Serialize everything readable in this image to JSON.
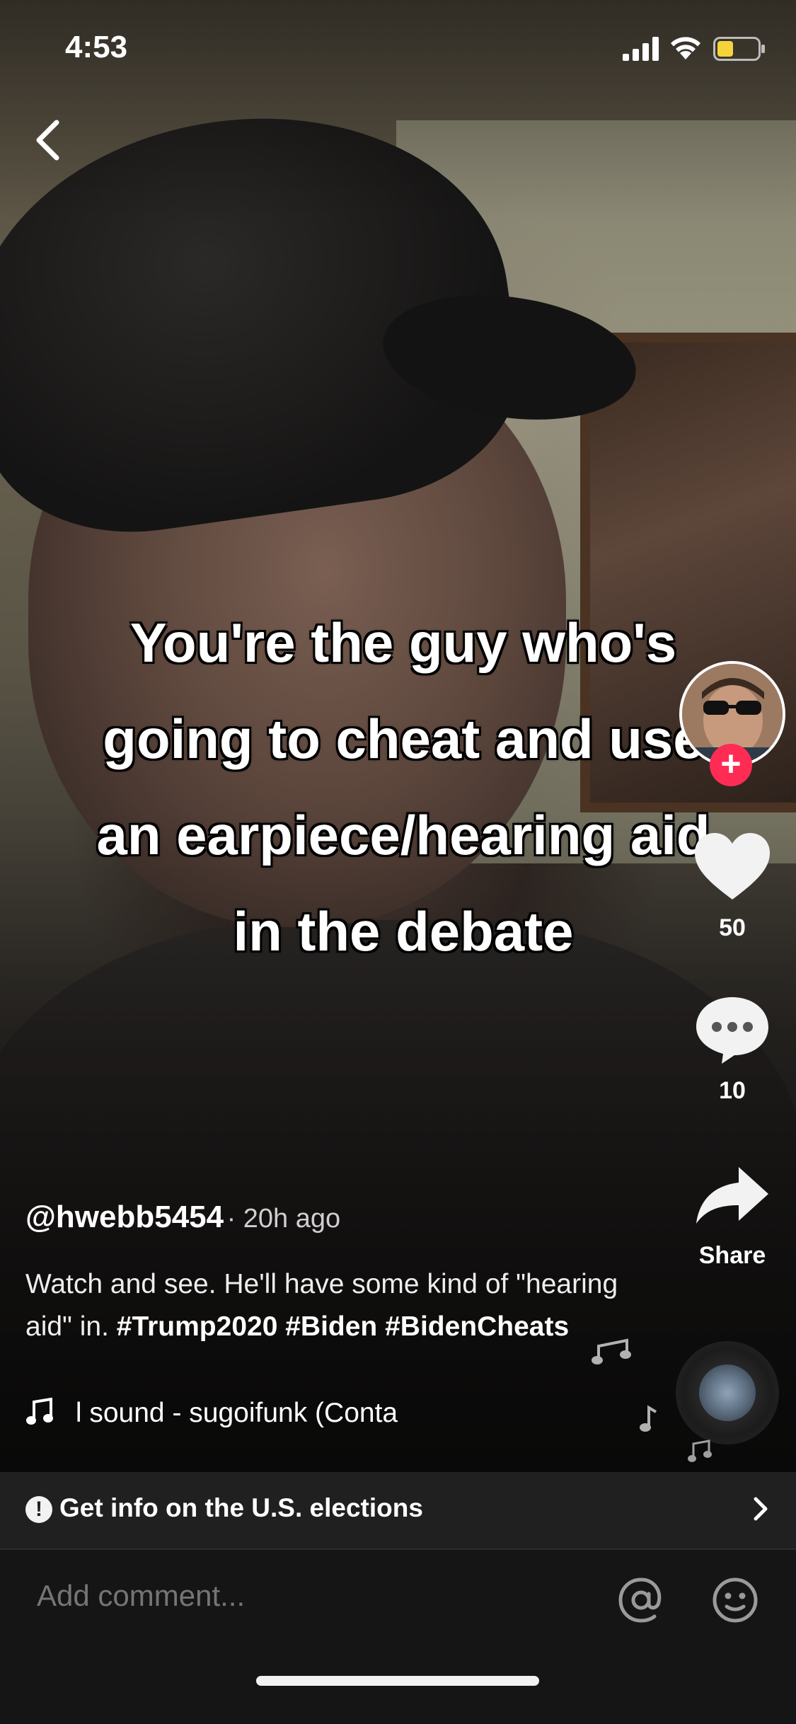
{
  "status_bar": {
    "time": "4:53"
  },
  "video": {
    "caption_lines": [
      "You're the guy who's",
      "going to cheat and use",
      "an earpiece/hearing aid",
      "in the debate"
    ]
  },
  "actions": {
    "like_count": "50",
    "comment_count": "10",
    "share_label": "Share"
  },
  "post": {
    "handle": "@hwebb5454",
    "age": "· 20h ago",
    "description_text": "Watch and see. He'll have some kind of \"hearing aid\" in.",
    "hashtags": [
      "#Trump2020",
      "#Biden",
      "#BidenCheats"
    ],
    "sound": "l sound - sugoifunk (Conta"
  },
  "elections_banner": {
    "label": "Get info on the U.S. elections"
  },
  "comment_bar": {
    "placeholder": "Add comment..."
  },
  "colors": {
    "follow_accent": "#fe2c55"
  },
  "icons": [
    "back-icon",
    "signal-icon",
    "wifi-icon",
    "battery-icon",
    "heart-icon",
    "comment-bubble-icon",
    "share-arrow-icon",
    "music-note-icon",
    "alert-icon",
    "chevron-right-icon",
    "at-icon",
    "emoji-icon"
  ]
}
